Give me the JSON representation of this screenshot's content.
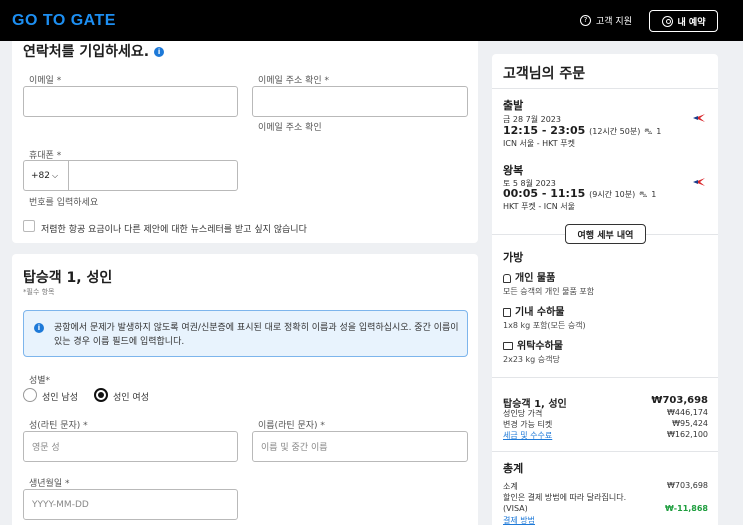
{
  "header": {
    "logo": "GO TO GATE",
    "support_label": "고객 지원",
    "booking_label": "내 예약"
  },
  "contact": {
    "title": "연락처를 기입하세요.",
    "email_label": "이메일 *",
    "email_confirm_label": "이메일 주소 확인 *",
    "email_confirm_hint": "이메일 주소 확인",
    "phone_label": "휴대폰 *",
    "phone_prefix": "+82",
    "phone_hint": "번호를 입력하세요",
    "newsletter_label": "저렴한 항공 요금이나 다른 제안에 대한 뉴스레터를 받고 싶지 않습니다"
  },
  "passenger": {
    "title": "탑승객 1, 성인",
    "required_note": "*필수 항목",
    "notice": "공항에서 문제가 발생하지 않도록 여권/신분증에 표시된 대로 정확히 이름과 성을 입력하십시오. 중간 이름이 있는 경우 이름 필드에 입력합니다.",
    "gender_label": "성별*",
    "gender_male": "성인 남성",
    "gender_female": "성인 여성",
    "gender_selected": "성인 여성",
    "lastname_label": "성(라틴 문자) *",
    "lastname_placeholder": "영문 성",
    "firstname_label": "이름(라틴 문자) *",
    "firstname_placeholder": "이름 및 중간 이름",
    "dob_label": "생년월일 *",
    "dob_placeholder": "YYYY-MM-DD"
  },
  "summary": {
    "title": "고객님의 주문",
    "outbound": {
      "heading": "출발",
      "date": "금 28 7월 2023",
      "time": "12:15 - 23:05",
      "duration": "(12시간 50분)",
      "stops": "1",
      "route": "ICN 서울 - HKT 푸켓"
    },
    "inbound": {
      "heading": "왕복",
      "date": "토 5 8월 2023",
      "time": "00:05 - 11:15",
      "duration": "(9시간 10분)",
      "stops": "1",
      "route": "HKT 푸켓 - ICN 서울"
    },
    "details_button": "여행 세부 내역",
    "baggage": {
      "title": "가방",
      "personal_title": "개인 물품",
      "personal_desc": "모든 승객의 개인 물품 포함",
      "cabin_title": "기내 수하물",
      "cabin_desc": "1x8 kg 포함(모든 승객)",
      "checked_title": "위탁수하물",
      "checked_desc": "2x23 kg 승객당"
    },
    "passenger_price": {
      "label": "탑승객 1, 성인",
      "total": "₩703,698",
      "rows": [
        {
          "label": "성인당 가격",
          "value": "₩446,174"
        },
        {
          "label": "변경 가능 티켓",
          "value": "₩95,424"
        },
        {
          "label": "세금 및 수수료",
          "value": "₩162,100"
        }
      ]
    },
    "total": {
      "title": "총계",
      "subtotal_label": "소계",
      "subtotal_value": "₩703,698",
      "discount_label": "할인은 결제 방법에 따라 달라집니다.",
      "visa_label": "(VISA)",
      "visa_value": "₩-11,868",
      "payment_link": "결제 방법"
    },
    "colors": {
      "accent": "#1d79d8",
      "discount": "#1e9e3e",
      "airline": "#d9262b"
    }
  }
}
